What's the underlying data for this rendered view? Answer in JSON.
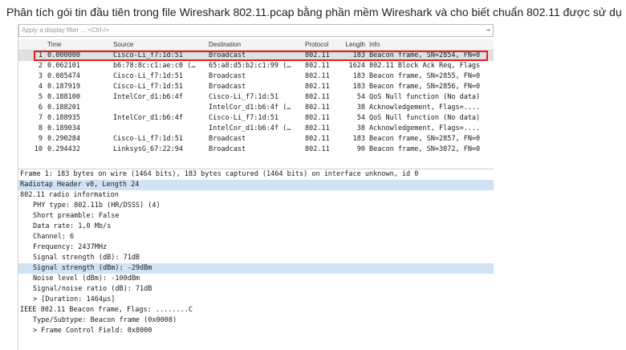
{
  "question": "Phân tích gói tin đầu tiên trong file Wireshark 802.11.pcap bằng phần mềm Wireshark và cho biết chuẩn 802.11 được sử dụng ở đây là gì?",
  "filter": {
    "placeholder": "Apply a display filter ... <Ctrl-/>"
  },
  "columns": {
    "no": "",
    "time": "Time",
    "source": "Source",
    "destination": "Destination",
    "protocol": "Protocol",
    "length": "Length",
    "info": "Info"
  },
  "packets": [
    {
      "no": "1",
      "time": "0.000000",
      "source": "Cisco-Li_f7:1d:51",
      "destination": "Broadcast",
      "protocol": "802.11",
      "length": "183",
      "info": "Beacon frame, SN=2854, FN=0"
    },
    {
      "no": "2",
      "time": "0.062101",
      "source": "b6:78:8c:c1:ae:c0 (…",
      "destination": "65:a8:d5:b2:c1:99 (…",
      "protocol": "802.11",
      "length": "1624",
      "info": "802.11 Block Ack Req, Flags"
    },
    {
      "no": "3",
      "time": "0.085474",
      "source": "Cisco-Li_f7:1d:51",
      "destination": "Broadcast",
      "protocol": "802.11",
      "length": "183",
      "info": "Beacon frame, SN=2855, FN=0"
    },
    {
      "no": "4",
      "time": "0.187919",
      "source": "Cisco-Li_f7:1d:51",
      "destination": "Broadcast",
      "protocol": "802.11",
      "length": "183",
      "info": "Beacon frame, SN=2856, FN=0"
    },
    {
      "no": "5",
      "time": "0.188100",
      "source": "IntelCor_d1:b6:4f",
      "destination": "Cisco-Li_f7:1d:51",
      "protocol": "802.11",
      "length": "54",
      "info": "QoS Null function (No data)"
    },
    {
      "no": "6",
      "time": "0.188201",
      "source": "",
      "destination": "IntelCor_d1:b6:4f (…",
      "protocol": "802.11",
      "length": "38",
      "info": "Acknowledgement, Flags=...."
    },
    {
      "no": "7",
      "time": "0.188935",
      "source": "IntelCor_d1:b6:4f",
      "destination": "Cisco-Li_f7:1d:51",
      "protocol": "802.11",
      "length": "54",
      "info": "QoS Null function (No data)"
    },
    {
      "no": "8",
      "time": "0.189034",
      "source": "",
      "destination": "IntelCor_d1:b6:4f (…",
      "protocol": "802.11",
      "length": "38",
      "info": "Acknowledgement, Flags=...."
    },
    {
      "no": "9",
      "time": "0.290284",
      "source": "Cisco-Li_f7:1d:51",
      "destination": "Broadcast",
      "protocol": "802.11",
      "length": "183",
      "info": "Beacon frame, SN=2857, FN=0"
    },
    {
      "no": "10",
      "time": "0.294432",
      "source": "LinksysG_67:22:94",
      "destination": "Broadcast",
      "protocol": "802.11",
      "length": "90",
      "info": "Beacon frame, SN=3072, FN=0"
    }
  ],
  "details": [
    {
      "text": "Frame 1: 183 bytes on wire (1464 bits), 183 bytes captured (1464 bits) on interface unknown, id 0",
      "indent": 0,
      "hl": false
    },
    {
      "text": "Radiotap Header v0, Length 24",
      "indent": 0,
      "hl": true
    },
    {
      "text": "802.11 radio information",
      "indent": 0,
      "hl": false
    },
    {
      "text": "PHY type: 802.11b (HR/DSSS) (4)",
      "indent": 1,
      "hl": false
    },
    {
      "text": "Short preamble: False",
      "indent": 1,
      "hl": false
    },
    {
      "text": "Data rate: 1,0 Mb/s",
      "indent": 1,
      "hl": false
    },
    {
      "text": "Channel: 6",
      "indent": 1,
      "hl": false
    },
    {
      "text": "Frequency: 2437MHz",
      "indent": 1,
      "hl": false
    },
    {
      "text": "Signal strength (dB): 71dB",
      "indent": 1,
      "hl": false
    },
    {
      "text": "Signal strength (dBm): -29dBm",
      "indent": 1,
      "hl": true
    },
    {
      "text": "Noise level (dBm): -100dBm",
      "indent": 1,
      "hl": false
    },
    {
      "text": "Signal/noise ratio (dB): 71dB",
      "indent": 1,
      "hl": false
    },
    {
      "text": "> [Duration: 1464μs]",
      "indent": 1,
      "hl": false
    },
    {
      "text": "IEEE 802.11 Beacon frame, Flags: ........C",
      "indent": 0,
      "hl": false
    },
    {
      "text": "Type/Subtype: Beacon frame (0x0008)",
      "indent": 1,
      "hl": false
    },
    {
      "text": "> Frame Control Field: 0x8000",
      "indent": 1,
      "hl": false
    }
  ]
}
